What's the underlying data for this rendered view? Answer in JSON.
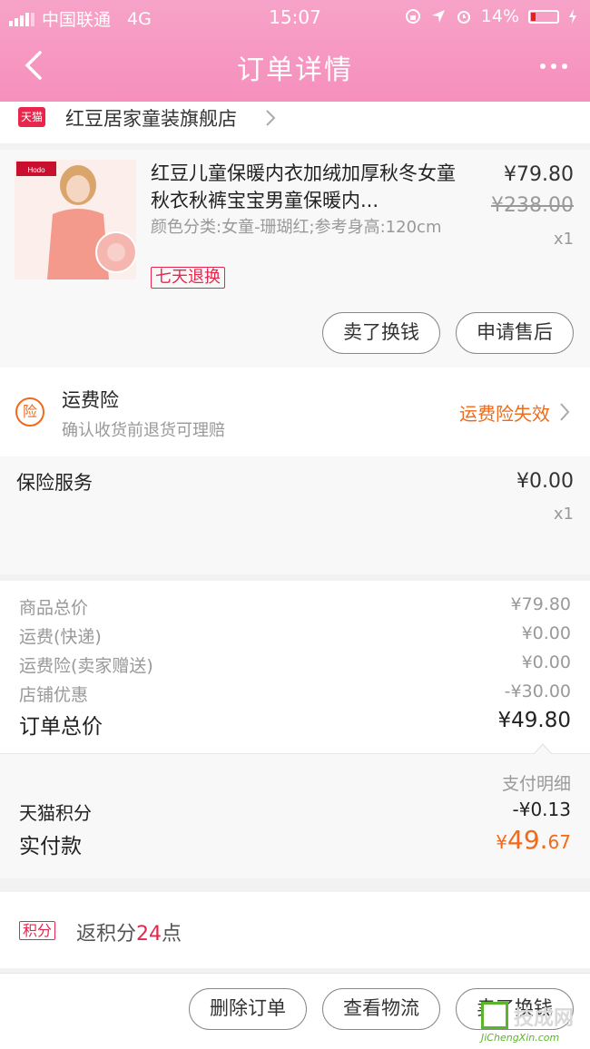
{
  "status_bar": {
    "carrier": "中国联通",
    "network": "4G",
    "time": "15:07",
    "battery": "14%"
  },
  "header": {
    "title": "订单详情"
  },
  "shop": {
    "badge": "天猫",
    "name": "红豆居家童装旗舰店"
  },
  "product": {
    "image_brand": "Hodo 红豆居家",
    "title": "红豆儿童保暖内衣加绒加厚秋冬女童秋衣秋裤宝宝男童保暖内...",
    "spec": "颜色分类:女童-珊瑚红;参考身高:120cm",
    "price": "¥79.80",
    "original_price": "¥238.00",
    "quantity": "x1",
    "return_tag": "七天退换",
    "btn_resell": "卖了换钱",
    "btn_aftersale": "申请售后"
  },
  "insurance": {
    "icon_text": "险",
    "title": "运费险",
    "subtitle": "确认收货前退货可理赔",
    "status": "运费险失效"
  },
  "service": {
    "title": "保险服务",
    "price": "¥0.00",
    "quantity": "x1"
  },
  "summary": {
    "rows": [
      {
        "label": "商品总价",
        "value": "¥79.80"
      },
      {
        "label": "运费(快递)",
        "value": "¥0.00"
      },
      {
        "label": "运费险(卖家赠送)",
        "value": "¥0.00"
      },
      {
        "label": "店铺优惠",
        "value": "-¥30.00"
      }
    ],
    "total_label": "订单总价",
    "total_value": "¥49.80"
  },
  "payment": {
    "detail_link": "支付明细",
    "points_label": "天猫积分",
    "points_value": "-¥0.13",
    "final_label": "实付款",
    "final_currency": "¥",
    "final_int": "49.",
    "final_dec": "67"
  },
  "rewards": {
    "badge": "积分",
    "text_prefix": "返积分",
    "number": "24",
    "text_suffix": "点"
  },
  "bottom_bar": {
    "btn_delete": "删除订单",
    "btn_logistics": "查看物流",
    "btn_resell": "卖了换钱"
  },
  "watermark": {
    "name": "技成网",
    "url": "JiChengXin.com"
  },
  "colors": {
    "header_pink": "#f68fbd",
    "tmall_red": "#e8254b",
    "orange": "#f06a1a"
  }
}
